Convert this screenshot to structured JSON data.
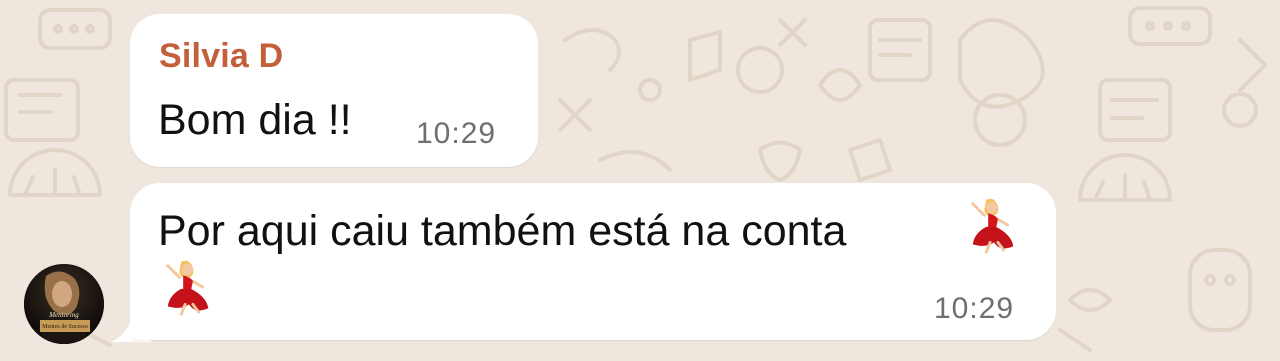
{
  "chat": {
    "messages": [
      {
        "sender": "Silvia D",
        "text": "Bom dia !!",
        "time": "10:29"
      },
      {
        "text": "Por aqui caiu também está na conta",
        "time": "10:29",
        "emojis": [
          "dancer-emoji",
          "dancer-emoji"
        ]
      }
    ],
    "avatar": {
      "line1": "Mentoring",
      "line2": "Mentes de Sucesso"
    }
  },
  "colors": {
    "wallpaper": "#efe7dd",
    "doodle": "#e3d8cb",
    "bubble": "#ffffff",
    "sender": "#c35f3a",
    "text": "#111111",
    "time": "#6f6f6f"
  }
}
